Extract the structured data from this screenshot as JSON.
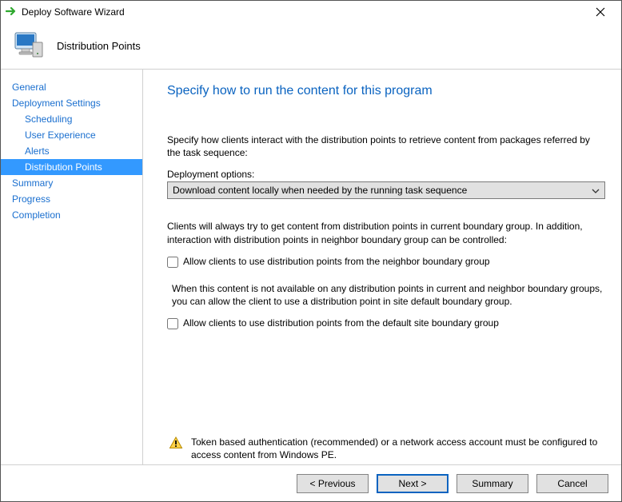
{
  "window": {
    "title": "Deploy Software Wizard"
  },
  "header": {
    "step_title": "Distribution Points"
  },
  "nav": {
    "items": [
      {
        "label": "General",
        "sub": false,
        "selected": false
      },
      {
        "label": "Deployment Settings",
        "sub": false,
        "selected": false
      },
      {
        "label": "Scheduling",
        "sub": true,
        "selected": false
      },
      {
        "label": "User Experience",
        "sub": true,
        "selected": false
      },
      {
        "label": "Alerts",
        "sub": true,
        "selected": false
      },
      {
        "label": "Distribution Points",
        "sub": true,
        "selected": true
      },
      {
        "label": "Summary",
        "sub": false,
        "selected": false
      },
      {
        "label": "Progress",
        "sub": false,
        "selected": false
      },
      {
        "label": "Completion",
        "sub": false,
        "selected": false
      }
    ]
  },
  "content": {
    "heading": "Specify how to run the content for this program",
    "intro": "Specify how clients interact with the distribution points to retrieve content from packages referred by the task sequence:",
    "dropdown_label": "Deployment options:",
    "dropdown_value": "Download content locally when needed by the running task sequence",
    "para_boundary": "Clients will always try to get content from distribution points in current boundary group. In addition, interaction with distribution points in neighbor boundary group can be controlled:",
    "checkbox1": "Allow clients to use distribution points from the neighbor boundary group",
    "para_default": "When this content is not available on any distribution points in current and neighbor boundary groups, you can allow the client to use a distribution point in site default boundary group.",
    "checkbox2": "Allow clients to use distribution points from the default site boundary group",
    "warning": "Token based authentication (recommended) or a network access account must be configured to access content from Windows PE."
  },
  "footer": {
    "previous": "< Previous",
    "next": "Next >",
    "summary": "Summary",
    "cancel": "Cancel"
  }
}
